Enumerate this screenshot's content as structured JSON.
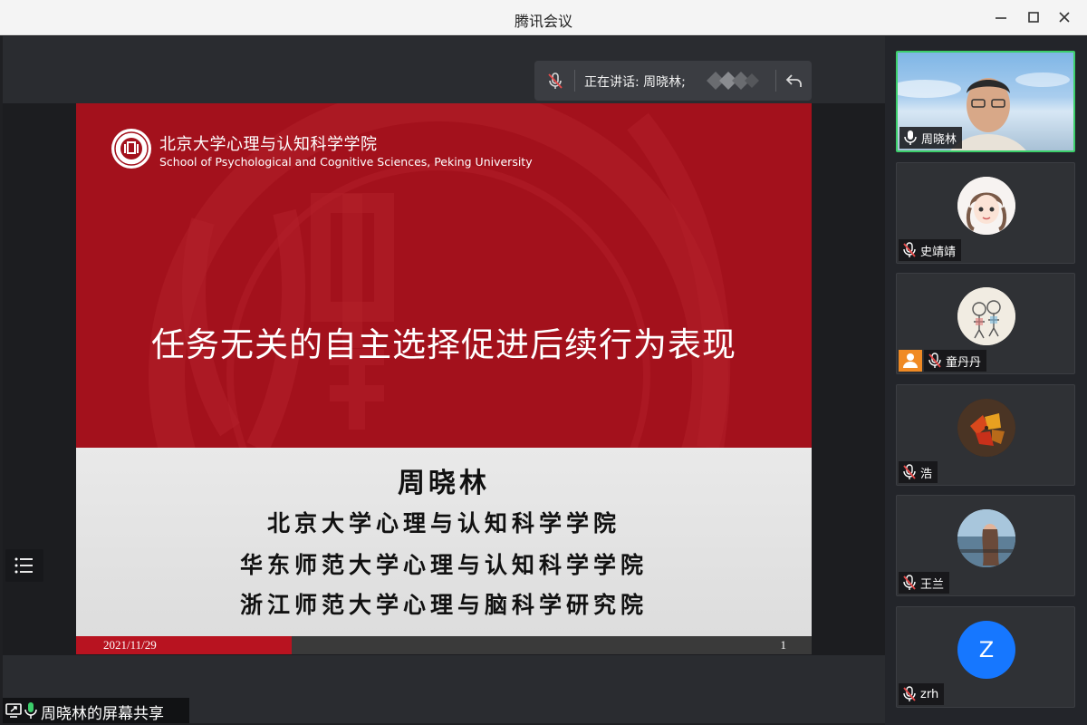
{
  "window": {
    "title": "腾讯会议"
  },
  "speaker_bar": {
    "label": "正在讲话: 周晓林;"
  },
  "slide": {
    "school_cn": "北京大学心理与认知科学学院",
    "school_en": "School of Psychological and Cognitive Sciences, Peking University",
    "title": "任务无关的自主选择促进后续行为表现",
    "author": "周晓林",
    "affiliations": [
      "北京大学心理与认知科学学院",
      "华东师范大学心理与认知科学学院",
      "浙江师范大学心理与脑科学研究院"
    ],
    "date": "2021/11/29",
    "page": "1"
  },
  "share_label": "周晓林的屏幕共享",
  "participants": [
    {
      "name": "周晓林",
      "mic": "on",
      "video": true,
      "active": true
    },
    {
      "name": "史靖靖",
      "mic": "muted"
    },
    {
      "name": "童丹丹",
      "mic": "muted",
      "badge": "orange-user"
    },
    {
      "name": "浩",
      "mic": "muted"
    },
    {
      "name": "王兰",
      "mic": "muted"
    },
    {
      "name": "zrh",
      "mic": "muted",
      "initial": "Z"
    }
  ],
  "colors": {
    "slide_red": "#a3111c",
    "active_border": "#3ccf6b",
    "avatar_blue": "#1677ff",
    "badge_orange": "#f08a24"
  }
}
